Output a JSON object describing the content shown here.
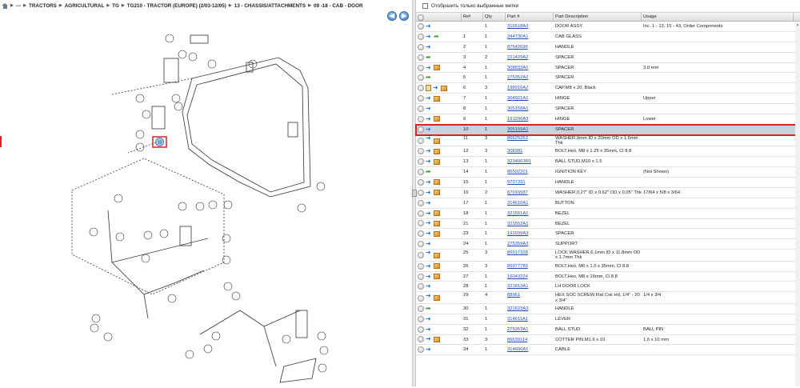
{
  "breadcrumb": {
    "items": [
      "---",
      "TRACTORS",
      "AGRICULTURAL",
      "TG",
      "TG210 - TRACTOR (EUROPE) (2/03-12/05)",
      "13 - CHASSIS/ATTACHMENTS",
      "09 -18 - CAB - DOOR"
    ]
  },
  "nav": {
    "back_glyph": "◀",
    "forward_glyph": "▶"
  },
  "filter": {
    "label": "Отобразить только выбранные метки"
  },
  "columns": {
    "ref": "Ref",
    "qty": "Qty",
    "part": "Part #",
    "desc": "Part Description",
    "usage": "Usage"
  },
  "diagram": {
    "selected_callout": "10"
  },
  "rows": [
    {
      "icons": [
        "circ",
        "blue"
      ],
      "ref": "",
      "qty": "1",
      "part": "316518A3",
      "desc": "DOOR ASSY.",
      "usage": "Inc. 1 - 13, 15 - 43, Order Components"
    },
    {
      "icons": [
        "circ",
        "blue",
        "green"
      ],
      "ref": "1",
      "qty": "1",
      "part": "344730A1",
      "desc": "CAB GLASS",
      "usage": ""
    },
    {
      "icons": [
        "circ",
        "blue"
      ],
      "ref": "2",
      "qty": "1",
      "part": "87542696",
      "desc": "HANDLE",
      "usage": ""
    },
    {
      "icons": [
        "circ",
        "green"
      ],
      "ref": "3",
      "qty": "2",
      "part": "221429A2",
      "desc": "SPACER",
      "usage": ""
    },
    {
      "icons": [
        "circ",
        "blue",
        "box"
      ],
      "ref": "4",
      "qty": "1",
      "part": "308833A1",
      "desc": "SPACER",
      "usage": "3,0 mm"
    },
    {
      "icons": [
        "circ",
        "green"
      ],
      "ref": "5",
      "qty": "1",
      "part": "275352A2",
      "desc": "SPACER",
      "usage": ""
    },
    {
      "icons": [
        "circ",
        "doc",
        "blue",
        "box"
      ],
      "ref": "6",
      "qty": "3",
      "part": "198916A2",
      "desc": "CAP,M8 x 20, Black",
      "usage": ""
    },
    {
      "icons": [
        "circ",
        "blue",
        "box"
      ],
      "ref": "7",
      "qty": "1",
      "part": "304921A1",
      "desc": "HINGE",
      "usage": "Upper"
    },
    {
      "icons": [
        "circ",
        "blue"
      ],
      "ref": "8",
      "qty": "1",
      "part": "305158A1",
      "desc": "SPACER",
      "usage": ""
    },
    {
      "icons": [
        "circ",
        "blue",
        "box"
      ],
      "ref": "9",
      "qty": "1",
      "part": "191206A3",
      "desc": "HINGE",
      "usage": "Lower"
    },
    {
      "icons": [
        "circ",
        "blue"
      ],
      "ref": "10",
      "qty": "1",
      "part": "305159A1",
      "desc": "SPACER",
      "usage": "",
      "selected": true
    },
    {
      "icons": [
        "circ",
        "blue",
        "box"
      ],
      "ref": "11",
      "qty": "3",
      "part": "86625263",
      "desc": "WASHER,9mm ID x 20mm OD x 1.6mm Thk",
      "usage": "",
      "two": true
    },
    {
      "icons": [
        "circ",
        "blue",
        "box"
      ],
      "ref": "12",
      "qty": "3",
      "part": "308381",
      "desc": "BOLT,Hex, M8 x 1.25 x 35mm, Cl 8.8",
      "usage": ""
    },
    {
      "icons": [
        "circ",
        "blue",
        "box"
      ],
      "ref": "13",
      "qty": "1",
      "part": "3234063R1",
      "desc": "BALL STUD,M10 x 1.5",
      "usage": ""
    },
    {
      "icons": [
        "circ",
        "green"
      ],
      "ref": "14",
      "qty": "1",
      "part": "86502201",
      "desc": "IGNITION KEY",
      "usage": "(Not Shown)"
    },
    {
      "icons": [
        "circ",
        "blue",
        "box"
      ],
      "ref": "15",
      "qty": "1",
      "part": "9707331",
      "desc": "HANDLE",
      "usage": ""
    },
    {
      "icons": [
        "circ",
        "blue",
        "box"
      ],
      "ref": "16",
      "qty": "2",
      "part": "87016587",
      "desc": "WASHER,0.27\" ID x 0.62\" OD x 0.05\" Thk",
      "usage": "17/64 x 5/8 x 3/64"
    },
    {
      "icons": [
        "circ",
        "blue"
      ],
      "ref": "17",
      "qty": "1",
      "part": "314610A1",
      "desc": "BUTTON",
      "usage": ""
    },
    {
      "icons": [
        "circ",
        "blue",
        "box"
      ],
      "ref": "18",
      "qty": "1",
      "part": "321551A1",
      "desc": "BEZEL",
      "usage": ""
    },
    {
      "icons": [
        "circ",
        "blue",
        "box"
      ],
      "ref": "21",
      "qty": "1",
      "part": "321552A1",
      "desc": "BEZEL",
      "usage": ""
    },
    {
      "icons": [
        "circ",
        "blue",
        "box"
      ],
      "ref": "23",
      "qty": "1",
      "part": "191939A3",
      "desc": "SPACER",
      "usage": ""
    },
    {
      "icons": [
        "circ",
        "blue"
      ],
      "ref": "24",
      "qty": "1",
      "part": "275359A3",
      "desc": "SUPPORT",
      "usage": ""
    },
    {
      "icons": [
        "circ",
        "blue",
        "box"
      ],
      "ref": "25",
      "qty": "3",
      "part": "86517328",
      "desc": "LOCK WASHER,6.1mm ID x 11.8mm OD x 1.7mm Thk",
      "usage": "",
      "two": true
    },
    {
      "icons": [
        "circ",
        "blue",
        "box"
      ],
      "ref": "26",
      "qty": "3",
      "part": "86977789",
      "desc": "BOLT,Hex, M6 x 1.0 x 35mm, Cl 8.8",
      "usage": ""
    },
    {
      "icons": [
        "circ",
        "blue",
        "box"
      ],
      "ref": "27",
      "qty": "1",
      "part": "16043224",
      "desc": "BOLT,Hex, M8 x 16mm, Cl 8.8",
      "usage": ""
    },
    {
      "icons": [
        "circ",
        "blue"
      ],
      "ref": "28",
      "qty": "1",
      "part": "321813A1",
      "desc": "LH DOOR LOCK",
      "usage": ""
    },
    {
      "icons": [
        "circ",
        "blue",
        "box"
      ],
      "ref": "29",
      "qty": "4",
      "part": "88961",
      "desc": "HEX SOC SCREW,Flat Csk Hd, 1/4\" - 20 x 3/4\"",
      "usage": "1/4 x 3/4",
      "two": true
    },
    {
      "icons": [
        "circ",
        "green"
      ],
      "ref": "30",
      "qty": "1",
      "part": "321623A3",
      "desc": "HANDLE",
      "usage": ""
    },
    {
      "icons": [
        "circ",
        "blue"
      ],
      "ref": "31",
      "qty": "1",
      "part": "314611A1",
      "desc": "LEVER",
      "usage": ""
    },
    {
      "icons": [
        "circ",
        "blue"
      ],
      "ref": "32",
      "qty": "1",
      "part": "275353A1",
      "desc": "BALL STUD",
      "usage": "BALL PIN"
    },
    {
      "icons": [
        "circ",
        "blue",
        "box"
      ],
      "ref": "33",
      "qty": "3",
      "part": "86639114",
      "desc": "COTTER PIN,M1.6 x 10",
      "usage": "1,6 x 10 mm"
    },
    {
      "icons": [
        "circ",
        "blue"
      ],
      "ref": "34",
      "qty": "1",
      "part": "314606A1",
      "desc": "CABLE",
      "usage": ""
    }
  ]
}
